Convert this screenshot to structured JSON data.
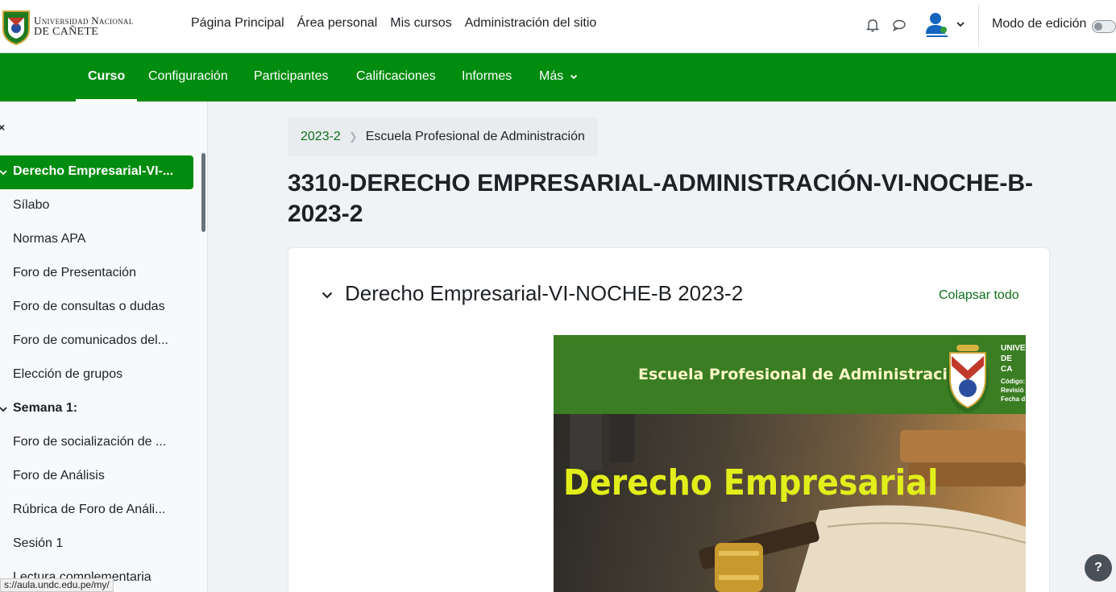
{
  "brand": {
    "line1": "Universidad Nacional",
    "line2": "de Cañete"
  },
  "primary_nav": [
    "Página Principal",
    "Área personal",
    "Mis cursos",
    "Administración del sitio"
  ],
  "header_right": {
    "edit_mode_label": "Modo de edición",
    "edit_mode_on": false
  },
  "secondary_nav": {
    "tabs": [
      "Curso",
      "Configuración",
      "Participantes",
      "Calificaciones",
      "Informes",
      "Más"
    ],
    "active": "Curso"
  },
  "drawer": {
    "active_section": "Derecho Empresarial-VI-...",
    "items": [
      "Sílabo",
      "Normas APA",
      "Foro de Presentación",
      "Foro de consultas o dudas",
      "Foro de comunicados del...",
      "Elección de grupos"
    ],
    "section2": "Semana 1:",
    "items2": [
      "Foro de socialización de ...",
      "Foro de Análisis",
      "Rúbrica de Foro de Análi...",
      "Sesión 1",
      "Lectura complementaria"
    ]
  },
  "breadcrumb": {
    "item1": "2023-2",
    "item2": "Escuela Profesional de Administración"
  },
  "page_title": "3310-DERECHO EMPRESARIAL-ADMINISTRACIÓN-VI-NOCHE-B-2023-2",
  "section": {
    "title": "Derecho Empresarial-VI-NOCHE-B 2023-2",
    "collapse_all": "Colapsar todo"
  },
  "banner": {
    "school": "Escuela Profesional de Administración",
    "heading": "Derecho Empresarial",
    "side_line1": "UNIVE",
    "side_line2": "DE CA",
    "side_small1": "Código:",
    "side_small2": "Revisió",
    "side_small3": "Fecha d"
  },
  "help_label": "?",
  "status_url": "s://aula.undc.edu.pe/my/",
  "colors": {
    "primary_green": "#008c0e",
    "link_green": "#0f6e1a",
    "banner_green": "#3a7d22",
    "banner_heading": "#e2ee1a"
  }
}
